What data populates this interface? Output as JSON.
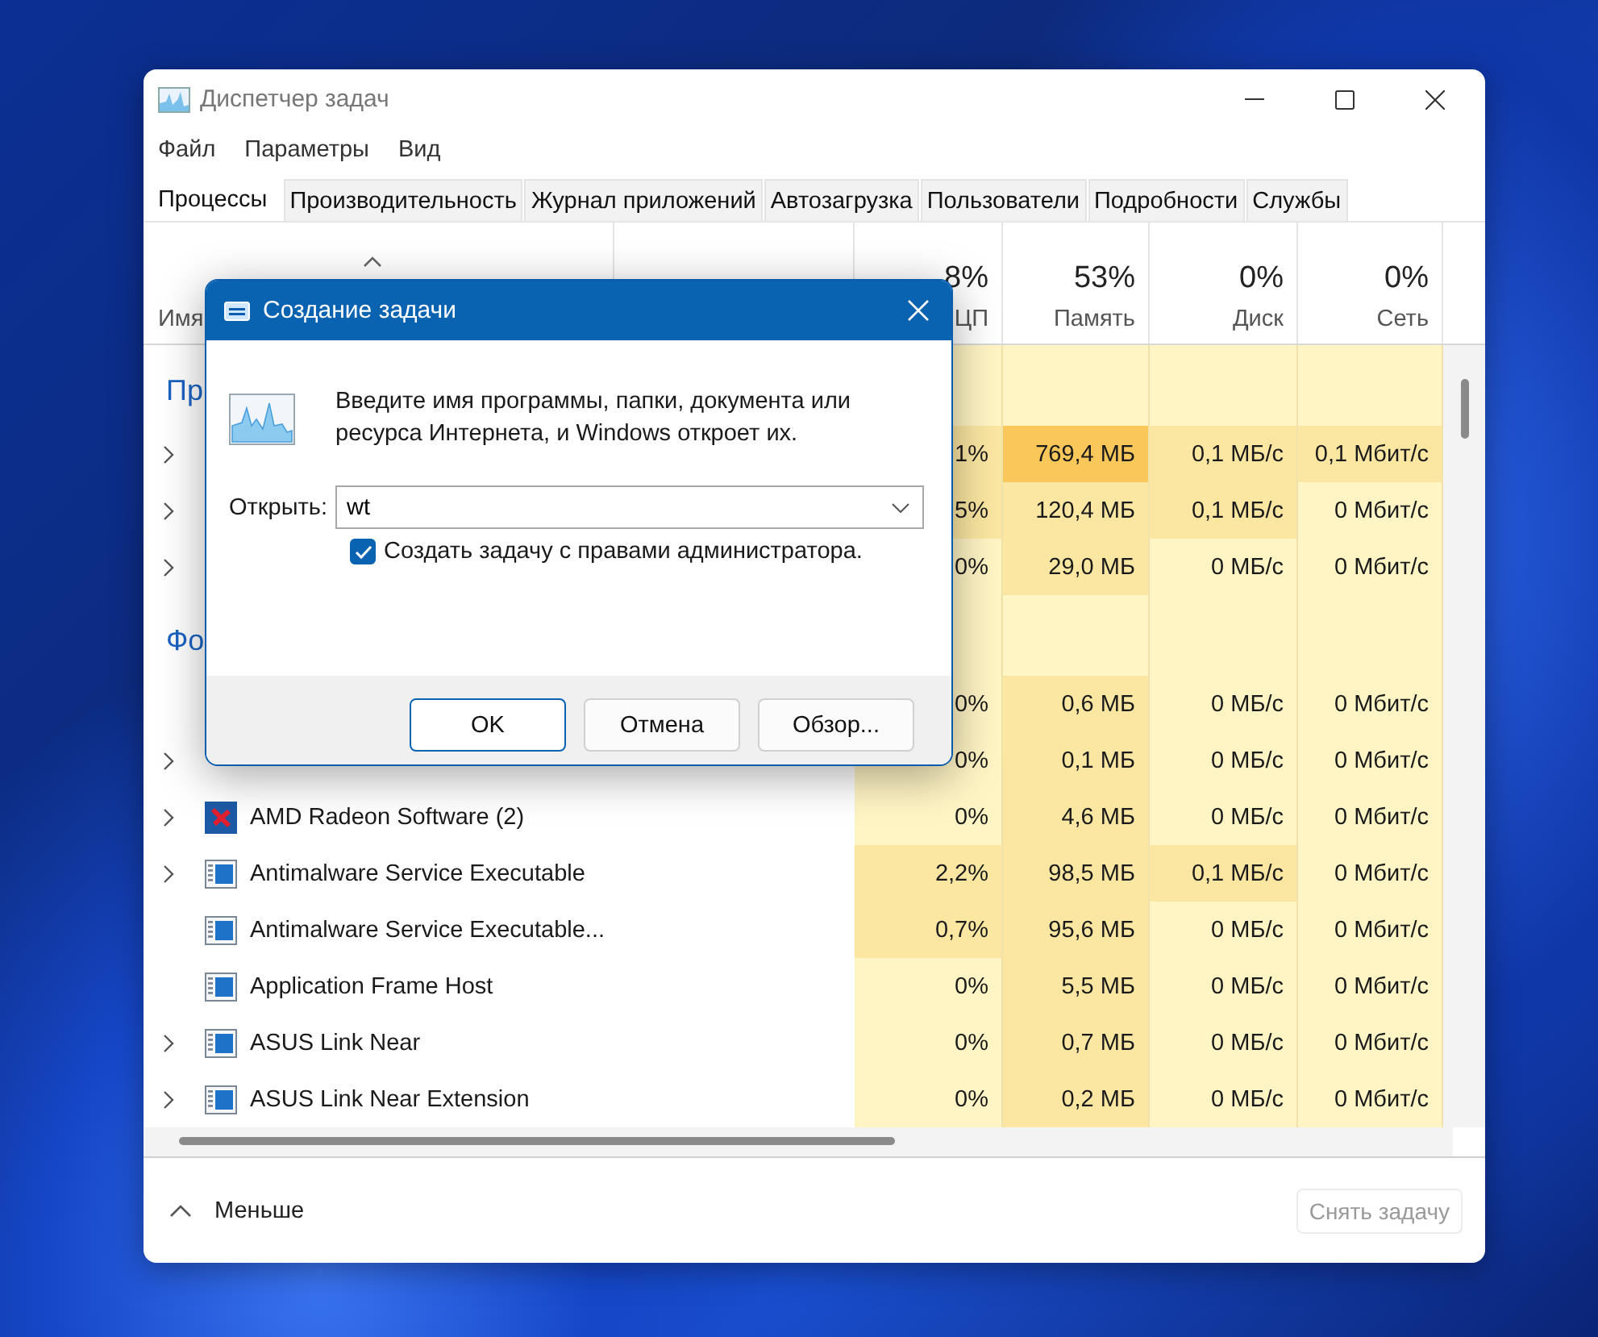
{
  "window": {
    "title": "Диспетчер задач"
  },
  "menu": [
    "Файл",
    "Параметры",
    "Вид"
  ],
  "tabs": [
    {
      "label": "Процессы",
      "selected": true
    },
    {
      "label": "Производительность",
      "selected": false
    },
    {
      "label": "Журнал приложений",
      "selected": false
    },
    {
      "label": "Автозагрузка",
      "selected": false
    },
    {
      "label": "Пользователи",
      "selected": false
    },
    {
      "label": "Подробности",
      "selected": false
    },
    {
      "label": "Службы",
      "selected": false
    }
  ],
  "table": {
    "name_column": "Имя",
    "columns": [
      {
        "percent": "8%",
        "label": "ЦП"
      },
      {
        "percent": "53%",
        "label": "Память"
      },
      {
        "percent": "0%",
        "label": "Диск"
      },
      {
        "percent": "0%",
        "label": "Сеть"
      }
    ],
    "rows": [
      {
        "kind": "group",
        "label": "Пр"
      },
      {
        "kind": "covered",
        "expandable": true,
        "cells": [
          {
            "text": "1%",
            "color": "#fbe7a2"
          },
          {
            "text": "769,4 МБ",
            "color": "#f9c75a"
          },
          {
            "text": "0,1 МБ/с",
            "color": "#fbe7a2"
          },
          {
            "text": "0,1 Мбит/с",
            "color": "#fbe7a2"
          }
        ]
      },
      {
        "kind": "covered",
        "expandable": true,
        "cells": [
          {
            "text": "5%",
            "color": "#fbe7a2"
          },
          {
            "text": "120,4 МБ",
            "color": "#fbe7a2"
          },
          {
            "text": "0,1 МБ/с",
            "color": "#fbe7a2"
          },
          {
            "text": "0 Мбит/с",
            "color": "#fff4c4"
          }
        ]
      },
      {
        "kind": "covered",
        "expandable": true,
        "cells": [
          {
            "text": "0%",
            "color": "#fff4c4"
          },
          {
            "text": "29,0 МБ",
            "color": "#fbe7a2"
          },
          {
            "text": "0 МБ/с",
            "color": "#fff4c4"
          },
          {
            "text": "0 Мбит/с",
            "color": "#fff4c4"
          }
        ]
      },
      {
        "kind": "group",
        "label": "Фо"
      },
      {
        "kind": "covered",
        "expandable": false,
        "cells": [
          {
            "text": "0%",
            "color": "#fff4c4"
          },
          {
            "text": "0,6 МБ",
            "color": "#fbe7a2"
          },
          {
            "text": "0 МБ/с",
            "color": "#fff4c4"
          },
          {
            "text": "0 Мбит/с",
            "color": "#fff4c4"
          }
        ]
      },
      {
        "kind": "covered",
        "expandable": true,
        "cells": [
          {
            "text": "0%",
            "color": "#fff4c4"
          },
          {
            "text": "0,1 МБ",
            "color": "#fbe7a2"
          },
          {
            "text": "0 МБ/с",
            "color": "#fff4c4"
          },
          {
            "text": "0 Мбит/с",
            "color": "#fff4c4"
          }
        ]
      },
      {
        "kind": "app-x",
        "expandable": true,
        "name": "AMD Radeon Software (2)",
        "cells": [
          {
            "text": "0%",
            "color": "#fff4c4"
          },
          {
            "text": "4,6 МБ",
            "color": "#fbe7a2"
          },
          {
            "text": "0 МБ/с",
            "color": "#fff4c4"
          },
          {
            "text": "0 Мбит/с",
            "color": "#fff4c4"
          }
        ]
      },
      {
        "kind": "app",
        "expandable": true,
        "name": "Antimalware Service Executable",
        "cells": [
          {
            "text": "2,2%",
            "color": "#fbe7a2"
          },
          {
            "text": "98,5 МБ",
            "color": "#fbe7a2"
          },
          {
            "text": "0,1 МБ/с",
            "color": "#fbe7a2"
          },
          {
            "text": "0 Мбит/с",
            "color": "#fff4c4"
          }
        ]
      },
      {
        "kind": "app",
        "expandable": false,
        "name": "Antimalware Service Executable...",
        "cells": [
          {
            "text": "0,7%",
            "color": "#fbe7a2"
          },
          {
            "text": "95,6 МБ",
            "color": "#fbe7a2"
          },
          {
            "text": "0 МБ/с",
            "color": "#fff4c4"
          },
          {
            "text": "0 Мбит/с",
            "color": "#fff4c4"
          }
        ]
      },
      {
        "kind": "app",
        "expandable": false,
        "name": "Application Frame Host",
        "cells": [
          {
            "text": "0%",
            "color": "#fff4c4"
          },
          {
            "text": "5,5 МБ",
            "color": "#fbe7a2"
          },
          {
            "text": "0 МБ/с",
            "color": "#fff4c4"
          },
          {
            "text": "0 Мбит/с",
            "color": "#fff4c4"
          }
        ]
      },
      {
        "kind": "app",
        "expandable": true,
        "name": "ASUS Link Near",
        "cells": [
          {
            "text": "0%",
            "color": "#fff4c4"
          },
          {
            "text": "0,7 МБ",
            "color": "#fbe7a2"
          },
          {
            "text": "0 МБ/с",
            "color": "#fff4c4"
          },
          {
            "text": "0 Мбит/с",
            "color": "#fff4c4"
          }
        ]
      },
      {
        "kind": "app",
        "expandable": true,
        "name": "ASUS Link Near Extension",
        "cells": [
          {
            "text": "0%",
            "color": "#fff4c4"
          },
          {
            "text": "0,2 МБ",
            "color": "#fbe7a2"
          },
          {
            "text": "0 МБ/с",
            "color": "#fff4c4"
          },
          {
            "text": "0 Мбит/с",
            "color": "#fff4c4"
          }
        ]
      }
    ]
  },
  "footer": {
    "toggle": "Меньше",
    "end_task": {
      "label": "Снять задачу",
      "disabled": true
    }
  },
  "dialog": {
    "title": "Создание задачи",
    "message": "Введите имя программы, папки, документа или ресурса Интернета, и Windows откроет их.",
    "open_label": "Открыть:",
    "open_value": "wt",
    "admin": {
      "label": "Создать задачу с правами администратора.",
      "checked": true
    },
    "buttons": [
      {
        "label": "OK",
        "kind": "default"
      },
      {
        "label": "Отмена",
        "kind": "normal"
      },
      {
        "label": "Обзор...",
        "kind": "normal"
      }
    ]
  }
}
